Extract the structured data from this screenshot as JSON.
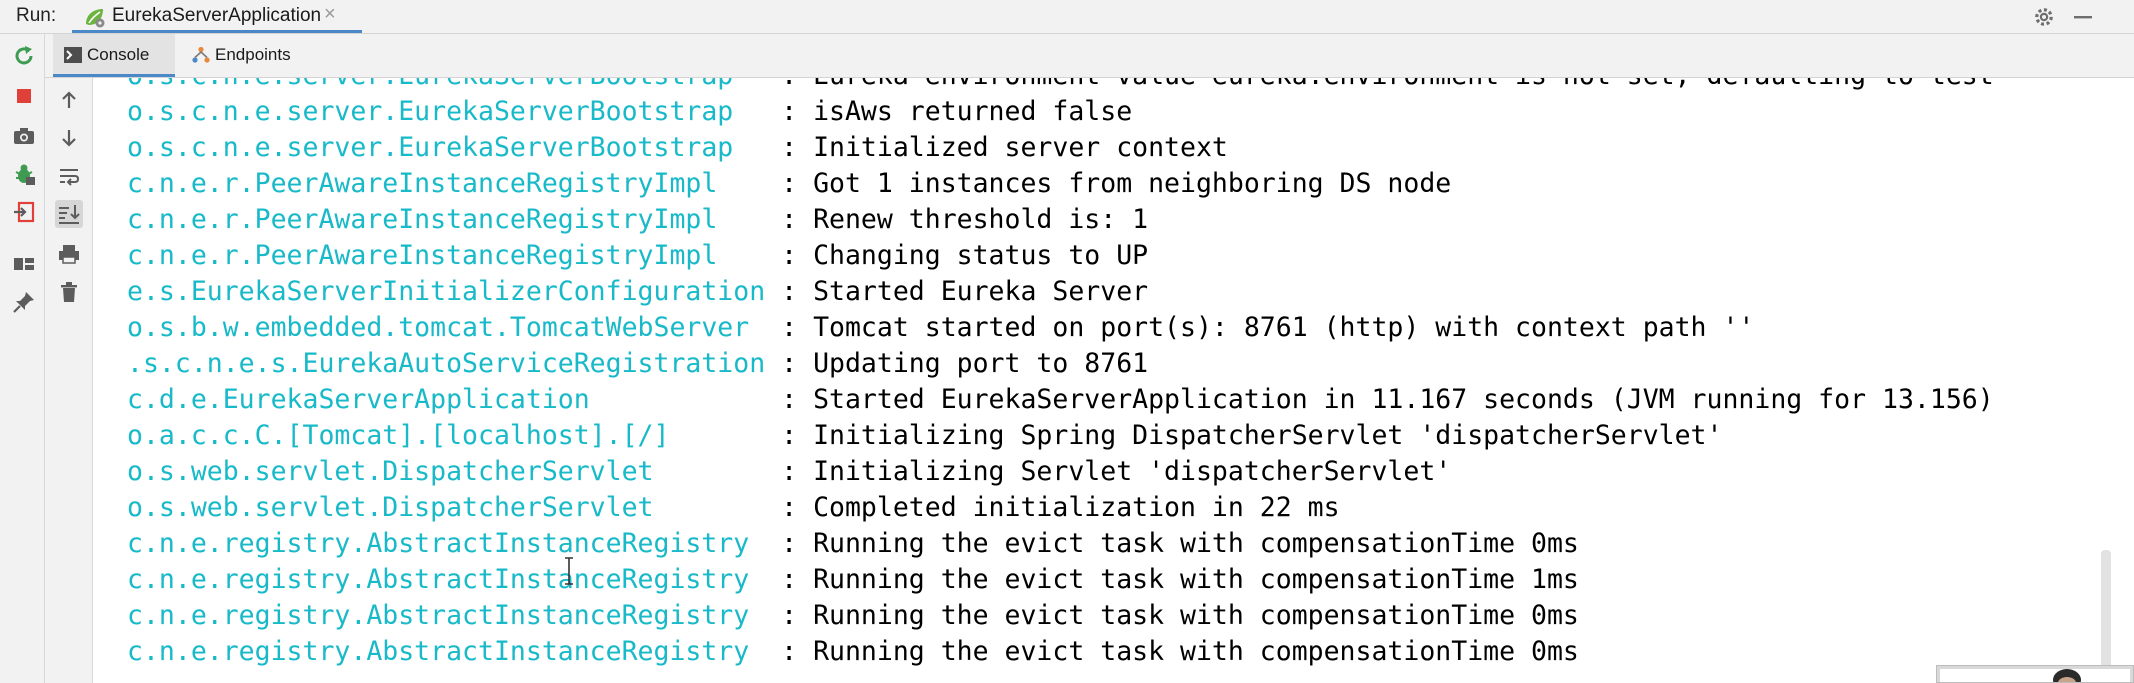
{
  "run_panel": {
    "label": "Run:",
    "tab_title": "EurekaServerApplication",
    "tab_close": "×"
  },
  "subtabs": [
    {
      "label": "Console",
      "icon": "console-icon",
      "active": true
    },
    {
      "label": "Endpoints",
      "icon": "endpoints-icon",
      "active": false
    }
  ],
  "log_lines": [
    {
      "logger": "o.s.c.n.e.server.EurekaServerBootstrap   ",
      "message": "Eureka environment value eureka.environment is not set, defaulting to test"
    },
    {
      "logger": "o.s.c.n.e.server.EurekaServerBootstrap   ",
      "message": "isAws returned false"
    },
    {
      "logger": "o.s.c.n.e.server.EurekaServerBootstrap   ",
      "message": "Initialized server context"
    },
    {
      "logger": "c.n.e.r.PeerAwareInstanceRegistryImpl    ",
      "message": "Got 1 instances from neighboring DS node"
    },
    {
      "logger": "c.n.e.r.PeerAwareInstanceRegistryImpl    ",
      "message": "Renew threshold is: 1"
    },
    {
      "logger": "c.n.e.r.PeerAwareInstanceRegistryImpl    ",
      "message": "Changing status to UP"
    },
    {
      "logger": "e.s.EurekaServerInitializerConfiguration ",
      "message": "Started Eureka Server"
    },
    {
      "logger": "o.s.b.w.embedded.tomcat.TomcatWebServer  ",
      "message": "Tomcat started on port(s): 8761 (http) with context path ''"
    },
    {
      "logger": ".s.c.n.e.s.EurekaAutoServiceRegistration ",
      "message": "Updating port to 8761"
    },
    {
      "logger": "c.d.e.EurekaServerApplication            ",
      "message": "Started EurekaServerApplication in 11.167 seconds (JVM running for 13.156)"
    },
    {
      "logger": "o.a.c.c.C.[Tomcat].[localhost].[/]       ",
      "message": "Initializing Spring DispatcherServlet 'dispatcherServlet'"
    },
    {
      "logger": "o.s.web.servlet.DispatcherServlet        ",
      "message": "Initializing Servlet 'dispatcherServlet'"
    },
    {
      "logger": "o.s.web.servlet.DispatcherServlet        ",
      "message": "Completed initialization in 22 ms"
    },
    {
      "logger": "c.n.e.registry.AbstractInstanceRegistry  ",
      "message": "Running the evict task with compensationTime 0ms"
    },
    {
      "logger": "c.n.e.registry.AbstractInstanceRegistry  ",
      "message": "Running the evict task with compensationTime 1ms"
    },
    {
      "logger": "c.n.e.registry.AbstractInstanceRegistry  ",
      "message": "Running the evict task with compensationTime 0ms"
    },
    {
      "logger": "c.n.e.registry.AbstractInstanceRegistry  ",
      "message": "Running the evict task with compensationTime 0ms"
    }
  ],
  "log_separator": ": ",
  "left_toolbar_icons": [
    "rerun-icon",
    "stop-icon",
    "screenshot-icon",
    "debug-bug-icon",
    "exit-icon",
    "layout-icon",
    "pin-icon"
  ],
  "console_toolbar_icons": [
    "up-arrow-icon",
    "down-arrow-icon",
    "soft-wrap-icon",
    "scroll-to-end-icon",
    "print-icon",
    "trash-icon"
  ],
  "colors": {
    "logger_text": "#18b9c8",
    "message_text": "#000000",
    "accent": "#4a88c7",
    "rerun_green": "#3f9b52",
    "stop_red": "#e0403a"
  }
}
